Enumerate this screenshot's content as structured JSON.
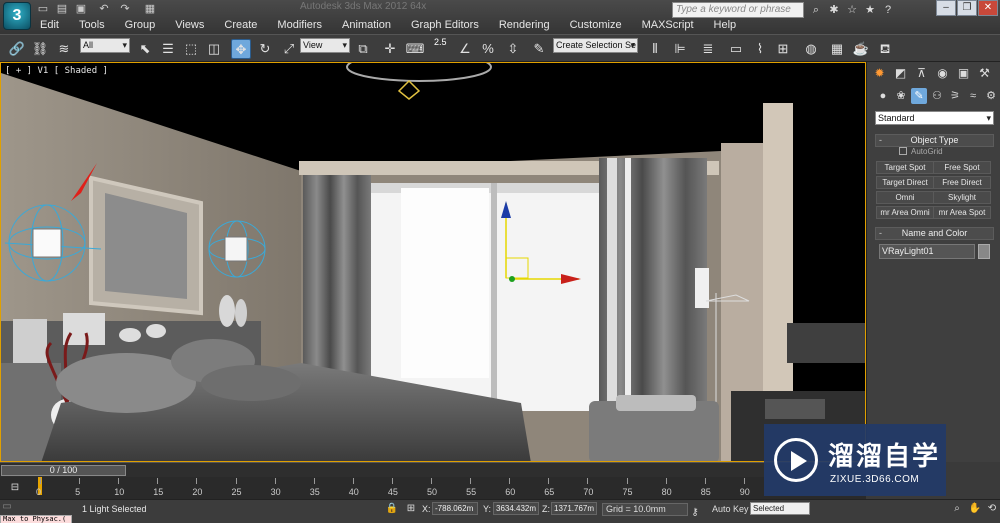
{
  "titlebar": {
    "app_logo": "3",
    "doc_title": "Autodesk 3ds Max 2012 64x",
    "search_placeholder": "Type a keyword or phrase"
  },
  "menu": [
    "Edit",
    "Tools",
    "Group",
    "Views",
    "Create",
    "Modifiers",
    "Animation",
    "Graph Editors",
    "Rendering",
    "Customize",
    "MAXScript",
    "Help"
  ],
  "toolbar": {
    "filter_value": "All",
    "refcoord_value": "View",
    "snap_label": "2.5",
    "named_selection_placeholder": "Create Selection Se"
  },
  "viewport": {
    "label": "[ + ] V1 [ Shaded ]"
  },
  "command_panel": {
    "category_value": "Standard",
    "object_type_title": "Object Type",
    "autogrid_label": "AutoGrid",
    "light_buttons": [
      "Target Spot",
      "Free Spot",
      "Target Direct",
      "Free Direct",
      "Omni",
      "Skylight",
      "mr Area Omni",
      "mr Area Spot"
    ],
    "name_color_title": "Name and Color",
    "object_name": "VRayLight01"
  },
  "timeline": {
    "slider_label": "0 / 100",
    "ticks": [
      "0",
      "5",
      "10",
      "15",
      "20",
      "25",
      "30",
      "35",
      "40",
      "45",
      "50",
      "55",
      "60",
      "65",
      "70",
      "75",
      "80",
      "85",
      "90"
    ]
  },
  "statusbar": {
    "maxscript_text": "Max to Physac.(",
    "status": "1 Light Selected",
    "x_label": "X:",
    "x_value": "-788.062m",
    "y_label": "Y:",
    "y_value": "3634.432m",
    "z_label": "Z:",
    "z_value": "1371.767m",
    "grid": "Grid = 10.0mm",
    "autokey": "Auto Key",
    "selected": "Selected"
  },
  "watermark": {
    "title": "溜溜自学",
    "url": "ZIXUE.3D66.COM"
  },
  "colors": {
    "accent": "#6fa8dc",
    "viewport_border": "#e0a000",
    "watermark_bg": "#223a68"
  }
}
